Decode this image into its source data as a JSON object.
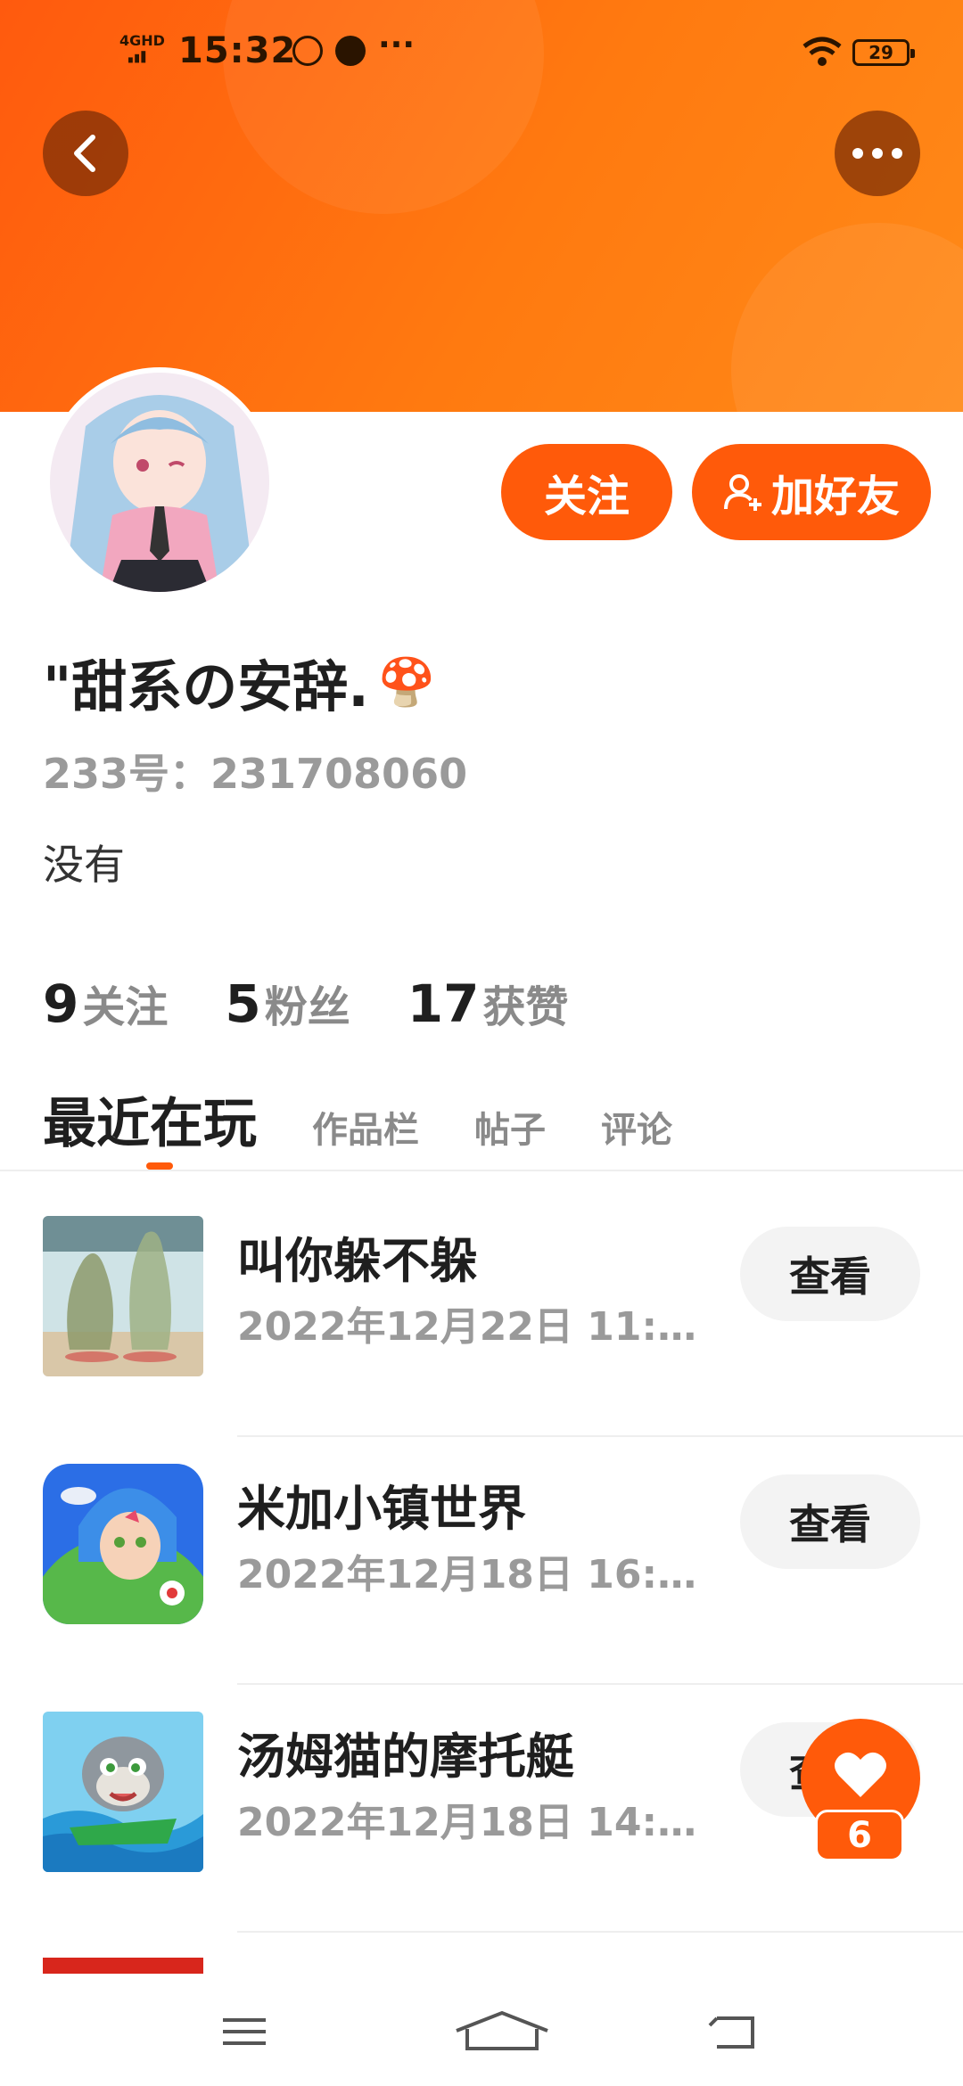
{
  "status_bar": {
    "network": "4GHD",
    "time": "15:32",
    "more": "···",
    "battery": "29"
  },
  "header": {
    "accent_color": "#ff5a0a"
  },
  "actions": {
    "follow_label": "关注",
    "add_friend_label": "加好友"
  },
  "profile": {
    "nickname": "\"甜系の安辞.",
    "emoji": "🍄",
    "uid": "233号：231708060",
    "bio": "没有"
  },
  "stats": [
    {
      "count": "9",
      "label": "关注"
    },
    {
      "count": "5",
      "label": "粉丝"
    },
    {
      "count": "17",
      "label": "获赞"
    }
  ],
  "tabs": [
    "最近在玩",
    "作品栏",
    "帖子",
    "评论"
  ],
  "games": [
    {
      "title": "叫你躲不躲",
      "time": "2022年12月22日  11:5…",
      "button": "查看",
      "icon": "game-thumb-hide-seek"
    },
    {
      "title": "米加小镇世界",
      "time": "2022年12月18日  16:3…",
      "button": "查看",
      "icon": "game-thumb-miga-town"
    },
    {
      "title": "汤姆猫的摩托艇",
      "time": "2022年12月18日  14:1…",
      "button": "查看",
      "icon": "game-thumb-tom-jetski"
    }
  ],
  "like": {
    "count": "6"
  }
}
